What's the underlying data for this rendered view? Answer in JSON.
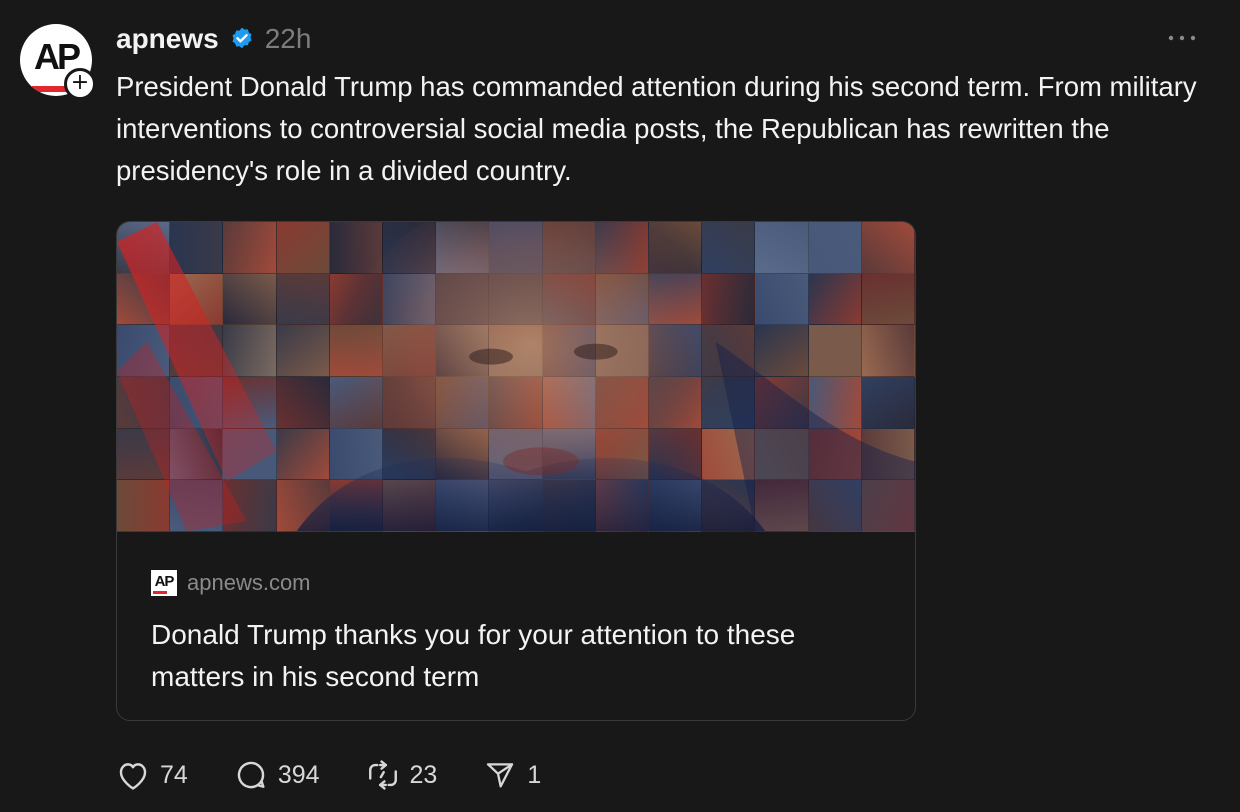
{
  "post": {
    "username": "apnews",
    "verified_icon": "verified-badge-icon",
    "timestamp": "22h",
    "avatar_text": "AP",
    "text": "President Donald Trump has commanded attention during his second term. From military interventions to controversial social media posts, the Republican has rewritten the presidency's role in a divided country."
  },
  "link_card": {
    "source_logo_text": "AP",
    "domain": "apnews.com",
    "title": "Donald Trump thanks you for your attention to these matters in his second term"
  },
  "actions": {
    "likes": "74",
    "replies": "394",
    "reposts": "23",
    "shares": "1"
  },
  "colors": {
    "background": "#181818",
    "verified_blue": "#1d9bf0",
    "ap_red": "#e0282e",
    "muted_text": "#7d7d7d"
  }
}
